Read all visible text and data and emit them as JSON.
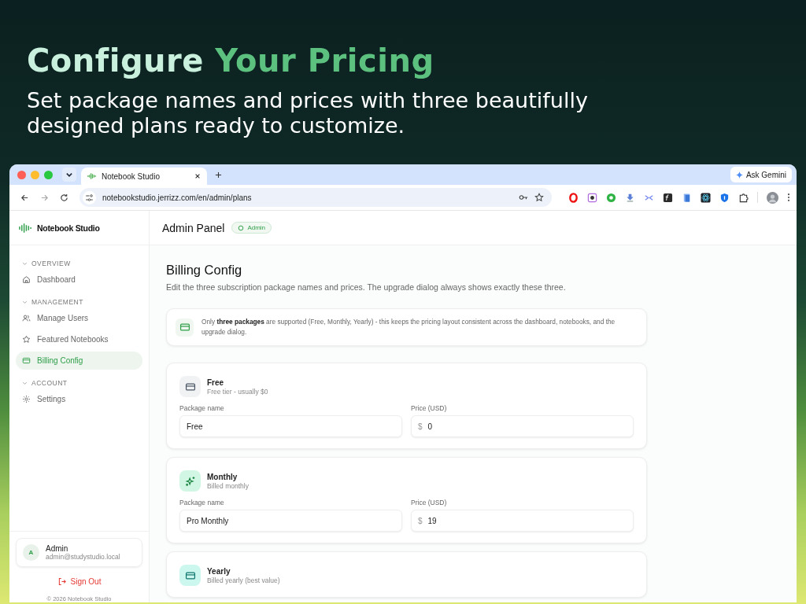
{
  "headline": {
    "lead": "Configure",
    "accent": "Your Pricing"
  },
  "subtitle": "Set package names and prices with three beautifully designed plans ready to customize.",
  "browser": {
    "tabs": [
      {
        "title": "Notebook Studio",
        "selected": true
      }
    ],
    "ask_button": "Ask Gemini",
    "url": "notebookstudio.jerrizz.com/en/admin/plans"
  },
  "sidebar": {
    "brand": "Notebook Studio",
    "sections": [
      {
        "title": "OVERVIEW",
        "expanded": true,
        "items": [
          {
            "label": "Dashboard",
            "kind": "home",
            "selected": false
          }
        ]
      },
      {
        "title": "MANAGEMENT",
        "expanded": true,
        "items": [
          {
            "label": "Manage Users",
            "kind": "users",
            "selected": false
          },
          {
            "label": "Featured Notebooks",
            "kind": "star",
            "selected": false
          },
          {
            "label": "Billing Config",
            "kind": "card",
            "selected": true
          }
        ]
      },
      {
        "title": "ACCOUNT",
        "expanded": true,
        "items": [
          {
            "label": "Settings",
            "kind": "gear",
            "selected": false
          }
        ]
      }
    ],
    "user": {
      "initial": "A",
      "name": "Admin",
      "email": "admin@studystudio.local"
    },
    "sign_out": "Sign Out",
    "footer": "© 2026 Notebook Studio"
  },
  "header": {
    "title": "Admin Panel",
    "badge": "Admin"
  },
  "page": {
    "title": "Billing Config",
    "description": "Edit the three subscription package names and prices. The upgrade dialog always shows exactly these three.",
    "notice": "Only **three packages** are supported (Free, Monthly, Yearly) - this keeps the pricing layout consistent across the dashboard, notebooks, and the upgrade dialog."
  },
  "plans": [
    {
      "name": "Free",
      "caption": "Free tier - usually $0",
      "kind": "card",
      "color": "#f1f2f4",
      "fields": [
        {
          "label": "Package name",
          "value": "Free"
        },
        {
          "label": "Price (USD)",
          "prefix": "$",
          "value": "0"
        }
      ]
    },
    {
      "name": "Monthly",
      "caption": "Billed monthly",
      "kind": "sparkle",
      "color": "#d1f7e4",
      "fields": [
        {
          "label": "Package name",
          "value": "Pro Monthly"
        },
        {
          "label": "Price (USD)",
          "prefix": "$",
          "value": "19"
        }
      ]
    },
    {
      "name": "Yearly",
      "caption": "Billed yearly (best value)",
      "kind": "card",
      "color": "#ccf7ef"
    }
  ]
}
